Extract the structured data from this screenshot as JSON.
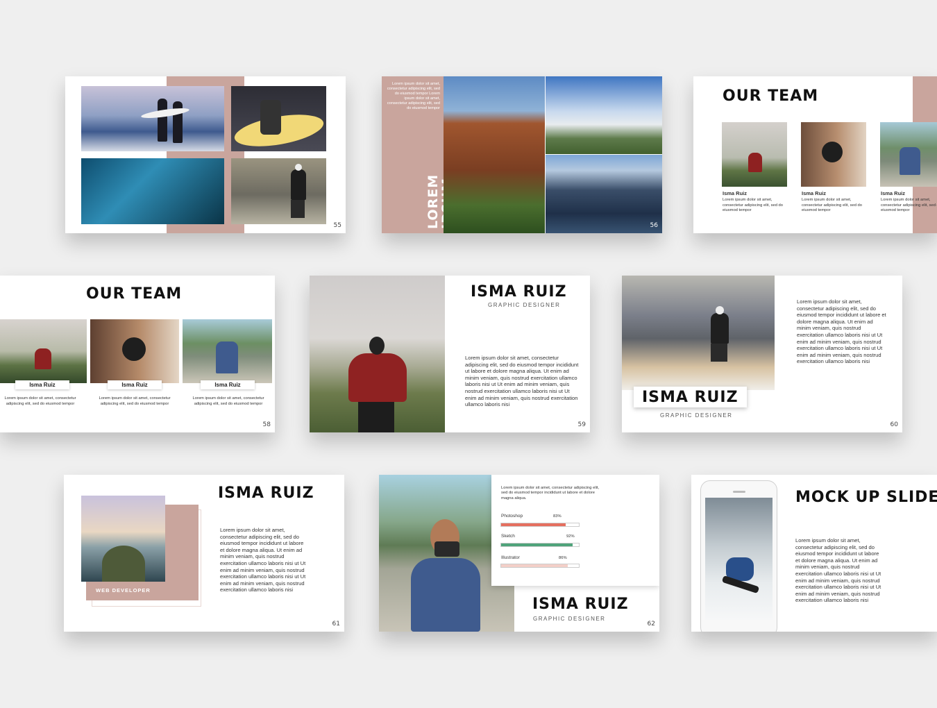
{
  "colors": {
    "accent": "#c9a59d",
    "bar_red": "#e56f5f",
    "bar_green": "#4fa37a",
    "bar_pink": "#f3cfc8"
  },
  "slides": {
    "s55": {
      "page": "55"
    },
    "s56": {
      "page": "56",
      "vertical_title": "LOREM IPSUM",
      "text": "Lorem ipsum dolor sit amet, consectetur adipiscing elit, sed do eiusmod tempor Lorem ipsum dolor sit amet, consectetur adipiscing elit, sed do eiusmod tempor"
    },
    "s57": {
      "title": "OUR TEAM",
      "members": [
        {
          "name": "Isma Ruiz",
          "text": "Lorem ipsum dolor sit amet, consectetur adipiscing elit, sed do eiusmod tempor"
        },
        {
          "name": "Isma Ruiz",
          "text": "Lorem ipsum dolor sit amet, consectetur adipiscing elit, sed do eiusmod tempor"
        },
        {
          "name": "Isma Ruiz",
          "text": "Lorem ipsum dolor sit amet, consectetur adipiscing elit, sed do eiusmod tempor"
        }
      ]
    },
    "s58": {
      "page": "58",
      "title": "OUR TEAM",
      "members": [
        {
          "name": "Isma Ruiz",
          "text": "Lorem ipsum dolor sit amet, consectetur adipiscing elit, sed do eiusmod tempor"
        },
        {
          "name": "Isma Ruiz",
          "text": "Lorem ipsum dolor sit amet, consectetur adipiscing elit, sed do eiusmod tempor"
        },
        {
          "name": "Isma Ruiz",
          "text": "Lorem ipsum dolor sit amet, consectetur adipiscing elit, sed do eiusmod tempor"
        }
      ]
    },
    "s59": {
      "page": "59",
      "title": "ISMA RUIZ",
      "subtitle": "GRAPHIC DESIGNER",
      "text": "Lorem ipsum dolor sit amet, consectetur adipiscing elit, sed do eiusmod tempor incididunt ut labore et dolore magna aliqua. Ut enim ad minim veniam, quis nostrud exercitation ullamco laboris nisi ut Ut enim ad minim veniam, quis nostrud exercitation ullamco laboris nisi ut Ut enim ad minim veniam, quis nostrud exercitation ullamco laboris nisi"
    },
    "s60": {
      "page": "60",
      "title": "ISMA RUIZ",
      "subtitle": "GRAPHIC DESIGNER",
      "text": "Lorem ipsum dolor sit amet, consectetur adipiscing elit, sed do eiusmod tempor incididunt ut labore et dolore magna aliqua. Ut enim ad minim veniam, quis nostrud exercitation ullamco laboris nisi ut Ut enim ad minim veniam, quis nostrud exercitation ullamco laboris nisi ut Ut enim ad minim veniam, quis nostrud exercitation ullamco laboris nisi"
    },
    "s61": {
      "page": "61",
      "title": "ISMA RUIZ",
      "role": "WEB DEVELOPER",
      "text": "Lorem ipsum dolor sit amet, consectetur adipiscing elit, sed do eiusmod tempor incididunt ut labore et dolore magna aliqua. Ut enim ad minim veniam, quis nostrud exercitation ullamco laboris nisi ut Ut enim ad minim veniam, quis nostrud exercitation ullamco laboris nisi ut Ut enim ad minim veniam, quis nostrud exercitation ullamco laboris nisi"
    },
    "s62": {
      "page": "62",
      "title": "ISMA RUIZ",
      "subtitle": "GRAPHIC DESIGNER",
      "text": "Lorem ipsum dolor sit amet, consectetur adipiscing elit, sed do eiusmod tempor incididunt ut labore et dolore magna aliqua.",
      "skills": [
        {
          "name": "Photoshop",
          "label": "83%",
          "value": 0.83,
          "color": "#e56f5f"
        },
        {
          "name": "Sketch",
          "label": "92%",
          "value": 0.92,
          "color": "#4fa37a"
        },
        {
          "name": "Illustrator",
          "label": "86%",
          "value": 0.86,
          "color": "#f3cfc8"
        }
      ]
    },
    "s63": {
      "title": "MOCK UP SLIDE",
      "text": "Lorem ipsum dolor sit amet, consectetur adipiscing elit, sed do eiusmod tempor incididunt ut labore et dolore magna aliqua. Ut enim ad minim veniam, quis nostrud exercitation ullamco laboris nisi ut Ut enim ad minim veniam, quis nostrud exercitation ullamco laboris nisi ut Ut enim ad minim veniam, quis nostrud exercitation ullamco laboris nisi"
    }
  }
}
